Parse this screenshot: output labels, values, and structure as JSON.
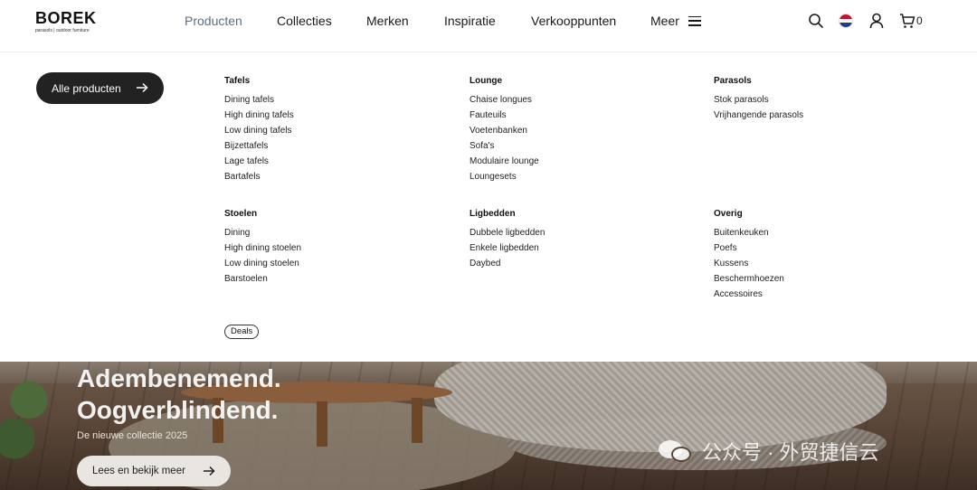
{
  "header": {
    "logo": {
      "main": "BOREK",
      "sub": "parasols | outdoor furniture"
    },
    "nav": [
      {
        "label": "Producten",
        "active": true
      },
      {
        "label": "Collecties"
      },
      {
        "label": "Merken"
      },
      {
        "label": "Inspiratie"
      },
      {
        "label": "Verkooppunten"
      },
      {
        "label": "Meer"
      }
    ],
    "icons": [
      "search-icon",
      "flag-nl-icon",
      "user-icon",
      "cart-icon",
      "menu-icon"
    ],
    "cart_count": "0",
    "active_color": "#5b6f86"
  },
  "mega_menu": {
    "all_button": "Alle producten",
    "columns": [
      {
        "title": "Tafels",
        "items": [
          "Dining tafels",
          "High dining tafels",
          "Low dining tafels",
          "Bijzettafels",
          "Lage tafels",
          "Bartafels"
        ]
      },
      {
        "title": "Lounge",
        "items": [
          "Chaise longues",
          "Fauteuils",
          "Voetenbanken",
          "Sofa's",
          "Modulaire lounge",
          "Loungesets"
        ]
      },
      {
        "title": "Parasols",
        "items": [
          "Stok parasols",
          "Vrijhangende parasols"
        ]
      },
      {
        "title": "Stoelen",
        "items": [
          "Dining",
          "High dining stoelen",
          "Low dining stoelen",
          "Barstoelen"
        ]
      },
      {
        "title": "Ligbedden",
        "items": [
          "Dubbele ligbedden",
          "Enkele ligbedden",
          "Daybed"
        ]
      },
      {
        "title": "Overig",
        "items": [
          "Buitenkeuken",
          "Poefs",
          "Kussens",
          "Beschermhoezen",
          "Accessoires"
        ]
      }
    ],
    "deals": "Deals"
  },
  "hero": {
    "title_line1": "Adembenemend.",
    "title_line2": "Oogverblindend.",
    "subtitle": "De nieuwe collectie 2025",
    "button": "Lees en bekijk meer"
  },
  "watermark": "公众号 · 外贸捷信云"
}
